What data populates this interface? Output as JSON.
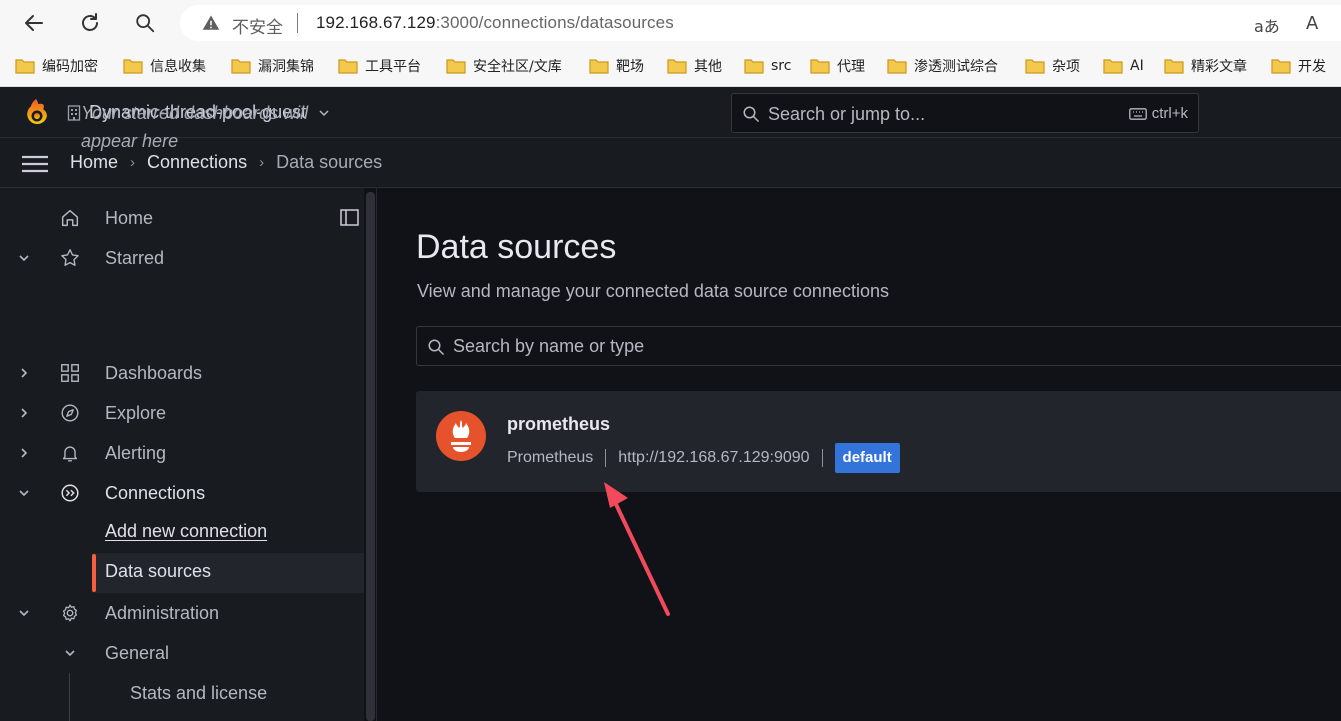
{
  "browser": {
    "insecure_label": "不安全",
    "url_host": "192.168.67.129",
    "url_rest": ":3000/connections/datasources",
    "read_aloud": "aあ",
    "font_btn": "A",
    "bookmarks": [
      "编码加密",
      "信息收集",
      "漏洞集锦",
      "工具平台",
      "安全社区/文库",
      "靶场",
      "其他",
      "src",
      "代理",
      "渗透测试综合",
      "杂项",
      "AI",
      "精彩文章",
      "开发"
    ]
  },
  "topbar": {
    "org_name": "Dynamic-thread-pool-guest",
    "search_placeholder": "Search or jump to...",
    "search_shortcut": "ctrl+k"
  },
  "breadcrumb": {
    "home": "Home",
    "connections": "Connections",
    "current": "Data sources"
  },
  "sidebar": {
    "home": "Home",
    "starred": "Starred",
    "starred_empty": "Your starred dashboards will appear here",
    "dashboards": "Dashboards",
    "explore": "Explore",
    "alerting": "Alerting",
    "connections": "Connections",
    "add_new_connection": "Add new connection",
    "data_sources": "Data sources",
    "administration": "Administration",
    "general": "General",
    "stats_and_license": "Stats and license"
  },
  "main": {
    "title": "Data sources",
    "subtitle": "View and manage your connected data source connections",
    "filter_placeholder": "Search by name or type",
    "datasources": [
      {
        "name": "prometheus",
        "type": "Prometheus",
        "url": "http://192.168.67.129:9090",
        "badge": "default"
      }
    ]
  },
  "colors": {
    "accent": "#f55f3e",
    "badge": "#3274d9",
    "background": "#111217",
    "panel": "#181b1f",
    "annotation_arrow": "#f2495c"
  }
}
